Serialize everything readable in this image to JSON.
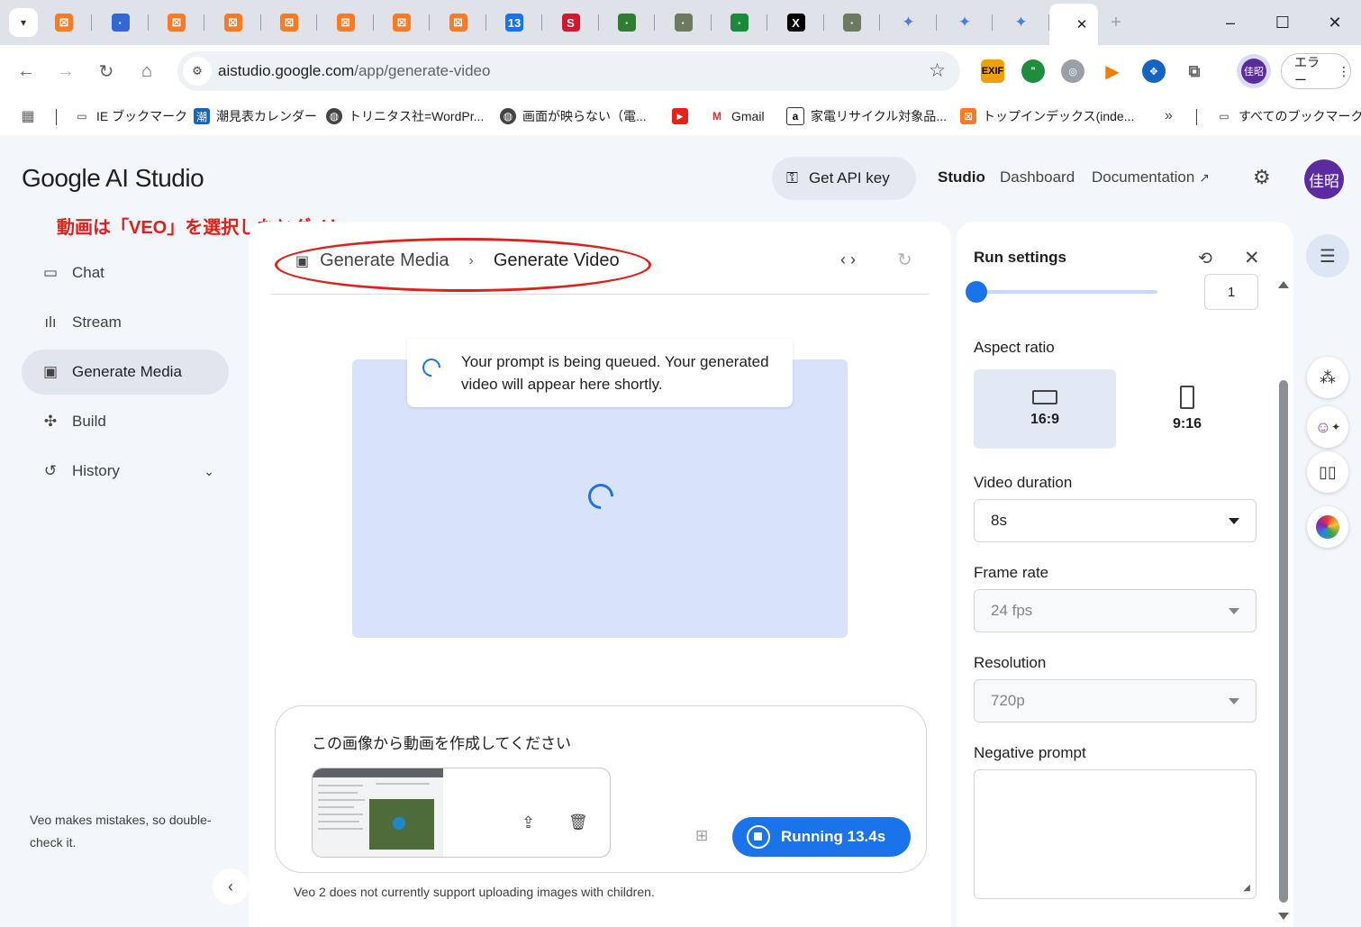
{
  "browser": {
    "url_host": "aistudio.google.com",
    "url_path": "/app/generate-video",
    "profile_label": "佳昭",
    "error_label": "エラー",
    "tabs": [
      {
        "icon": "xampp-icon",
        "color": "#fb7a24"
      },
      {
        "icon": "cube-icon",
        "color": "#3367d6"
      },
      {
        "icon": "xampp-icon",
        "color": "#fb7a24"
      },
      {
        "icon": "xampp-icon",
        "color": "#fb7a24"
      },
      {
        "icon": "xampp-icon",
        "color": "#fb7a24"
      },
      {
        "icon": "xampp-icon",
        "color": "#fb7a24"
      },
      {
        "icon": "xampp-icon",
        "color": "#fb7a24"
      },
      {
        "icon": "xampp-icon",
        "color": "#fb7a24"
      },
      {
        "icon": "calendar-icon",
        "color": "#1a73e8",
        "text": "13"
      },
      {
        "icon": "s-logo-icon",
        "color": "#d3172e",
        "text": "S"
      },
      {
        "icon": "chart-icon",
        "color": "#2e7d32"
      },
      {
        "icon": "page-icon",
        "color": "#6d7a62"
      },
      {
        "icon": "globe-icon",
        "color": "#1b8a3a"
      },
      {
        "icon": "x-icon",
        "color": "#000000",
        "text": "X"
      },
      {
        "icon": "page-icon",
        "color": "#6d7a62"
      },
      {
        "icon": "gemini-icon",
        "color": "#4a7cf0"
      },
      {
        "icon": "gemini-icon",
        "color": "#4a7cf0"
      },
      {
        "icon": "gemini-icon",
        "color": "#4a7cf0"
      }
    ],
    "bookmarks": [
      {
        "label": "IE ブックマーク",
        "icon": "folder-icon"
      },
      {
        "label": "潮見表カレンダー",
        "icon": "tide-icon"
      },
      {
        "label": "トリニタス社=WordPr...",
        "icon": "globe-icon"
      },
      {
        "label": "画面が映らない（電...",
        "icon": "globe-icon"
      },
      {
        "label": "",
        "icon": "youtube-icon"
      },
      {
        "label": "Gmail",
        "icon": "gmail-icon"
      },
      {
        "label": "家電リサイクル対象品...",
        "icon": "amazon-icon"
      },
      {
        "label": "トップインデックス(inde...",
        "icon": "xampp-icon"
      }
    ],
    "all_bookmarks": "すべてのブックマーク"
  },
  "header": {
    "logo_google": "Google",
    "logo_rest": " AI Studio",
    "get_api_key": "Get API key",
    "nav": [
      "Studio",
      "Dashboard",
      "Documentation"
    ]
  },
  "annotation": "動画は「VEO」を選択しなとダメ！",
  "sidebar": {
    "items": [
      {
        "label": "Chat",
        "icon": "chat-icon"
      },
      {
        "label": "Stream",
        "icon": "stream-icon"
      },
      {
        "label": "Generate Media",
        "icon": "image-icon"
      },
      {
        "label": "Build",
        "icon": "build-icon"
      },
      {
        "label": "History",
        "icon": "history-icon"
      }
    ],
    "note": "Veo makes mistakes, so double-check it."
  },
  "main": {
    "breadcrumb": [
      "Generate Media",
      "Generate Video"
    ],
    "queue_message": "Your prompt is being queued. Your generated video will appear here shortly.",
    "prompt_text": "この画像から動画を作成してください",
    "run_label": "Running 13.4s",
    "footer_note": "Veo 2 does not currently support uploading images with children."
  },
  "settings": {
    "title": "Run settings",
    "slider_value": "1",
    "aspect_ratio_label": "Aspect ratio",
    "aspect_options": [
      "16:9",
      "9:16"
    ],
    "aspect_selected": "16:9",
    "duration_label": "Video duration",
    "duration_value": "8s",
    "framerate_label": "Frame rate",
    "framerate_value": "24 fps",
    "resolution_label": "Resolution",
    "resolution_value": "720p",
    "negative_label": "Negative prompt",
    "negative_value": ""
  },
  "colors": {
    "accent": "#1a73e8",
    "annotation": "#e0201b",
    "avatar": "#5b2c9f",
    "page_bg": "#f3f6fb",
    "video_placeholder": "#d9e2fb"
  }
}
